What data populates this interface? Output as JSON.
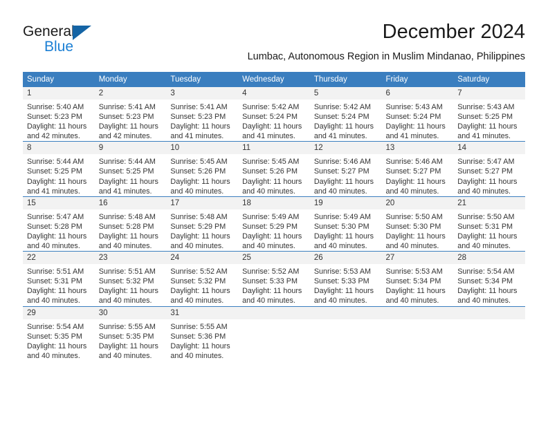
{
  "logo": {
    "primary_text": "General",
    "secondary_text": "Blue",
    "triangle_color": "#1464a5",
    "secondary_color": "#1b7fd4"
  },
  "header": {
    "month_title": "December 2024",
    "location": "Lumbac, Autonomous Region in Muslim Mindanao, Philippines"
  },
  "theme": {
    "header_bg": "#3a7ebf",
    "header_text": "#ffffff",
    "daynum_band_bg": "#f2f2f2",
    "cell_bg": "#ffffff",
    "row_border": "#3a7ebf",
    "body_text": "#333333"
  },
  "weekdays": [
    "Sunday",
    "Monday",
    "Tuesday",
    "Wednesday",
    "Thursday",
    "Friday",
    "Saturday"
  ],
  "calendar": {
    "weeks": [
      [
        {
          "day": "1",
          "sunrise": "Sunrise: 5:40 AM",
          "sunset": "Sunset: 5:23 PM",
          "daylight_line1": "Daylight: 11 hours",
          "daylight_line2": "and 42 minutes."
        },
        {
          "day": "2",
          "sunrise": "Sunrise: 5:41 AM",
          "sunset": "Sunset: 5:23 PM",
          "daylight_line1": "Daylight: 11 hours",
          "daylight_line2": "and 42 minutes."
        },
        {
          "day": "3",
          "sunrise": "Sunrise: 5:41 AM",
          "sunset": "Sunset: 5:23 PM",
          "daylight_line1": "Daylight: 11 hours",
          "daylight_line2": "and 41 minutes."
        },
        {
          "day": "4",
          "sunrise": "Sunrise: 5:42 AM",
          "sunset": "Sunset: 5:24 PM",
          "daylight_line1": "Daylight: 11 hours",
          "daylight_line2": "and 41 minutes."
        },
        {
          "day": "5",
          "sunrise": "Sunrise: 5:42 AM",
          "sunset": "Sunset: 5:24 PM",
          "daylight_line1": "Daylight: 11 hours",
          "daylight_line2": "and 41 minutes."
        },
        {
          "day": "6",
          "sunrise": "Sunrise: 5:43 AM",
          "sunset": "Sunset: 5:24 PM",
          "daylight_line1": "Daylight: 11 hours",
          "daylight_line2": "and 41 minutes."
        },
        {
          "day": "7",
          "sunrise": "Sunrise: 5:43 AM",
          "sunset": "Sunset: 5:25 PM",
          "daylight_line1": "Daylight: 11 hours",
          "daylight_line2": "and 41 minutes."
        }
      ],
      [
        {
          "day": "8",
          "sunrise": "Sunrise: 5:44 AM",
          "sunset": "Sunset: 5:25 PM",
          "daylight_line1": "Daylight: 11 hours",
          "daylight_line2": "and 41 minutes."
        },
        {
          "day": "9",
          "sunrise": "Sunrise: 5:44 AM",
          "sunset": "Sunset: 5:25 PM",
          "daylight_line1": "Daylight: 11 hours",
          "daylight_line2": "and 41 minutes."
        },
        {
          "day": "10",
          "sunrise": "Sunrise: 5:45 AM",
          "sunset": "Sunset: 5:26 PM",
          "daylight_line1": "Daylight: 11 hours",
          "daylight_line2": "and 40 minutes."
        },
        {
          "day": "11",
          "sunrise": "Sunrise: 5:45 AM",
          "sunset": "Sunset: 5:26 PM",
          "daylight_line1": "Daylight: 11 hours",
          "daylight_line2": "and 40 minutes."
        },
        {
          "day": "12",
          "sunrise": "Sunrise: 5:46 AM",
          "sunset": "Sunset: 5:27 PM",
          "daylight_line1": "Daylight: 11 hours",
          "daylight_line2": "and 40 minutes."
        },
        {
          "day": "13",
          "sunrise": "Sunrise: 5:46 AM",
          "sunset": "Sunset: 5:27 PM",
          "daylight_line1": "Daylight: 11 hours",
          "daylight_line2": "and 40 minutes."
        },
        {
          "day": "14",
          "sunrise": "Sunrise: 5:47 AM",
          "sunset": "Sunset: 5:27 PM",
          "daylight_line1": "Daylight: 11 hours",
          "daylight_line2": "and 40 minutes."
        }
      ],
      [
        {
          "day": "15",
          "sunrise": "Sunrise: 5:47 AM",
          "sunset": "Sunset: 5:28 PM",
          "daylight_line1": "Daylight: 11 hours",
          "daylight_line2": "and 40 minutes."
        },
        {
          "day": "16",
          "sunrise": "Sunrise: 5:48 AM",
          "sunset": "Sunset: 5:28 PM",
          "daylight_line1": "Daylight: 11 hours",
          "daylight_line2": "and 40 minutes."
        },
        {
          "day": "17",
          "sunrise": "Sunrise: 5:48 AM",
          "sunset": "Sunset: 5:29 PM",
          "daylight_line1": "Daylight: 11 hours",
          "daylight_line2": "and 40 minutes."
        },
        {
          "day": "18",
          "sunrise": "Sunrise: 5:49 AM",
          "sunset": "Sunset: 5:29 PM",
          "daylight_line1": "Daylight: 11 hours",
          "daylight_line2": "and 40 minutes."
        },
        {
          "day": "19",
          "sunrise": "Sunrise: 5:49 AM",
          "sunset": "Sunset: 5:30 PM",
          "daylight_line1": "Daylight: 11 hours",
          "daylight_line2": "and 40 minutes."
        },
        {
          "day": "20",
          "sunrise": "Sunrise: 5:50 AM",
          "sunset": "Sunset: 5:30 PM",
          "daylight_line1": "Daylight: 11 hours",
          "daylight_line2": "and 40 minutes."
        },
        {
          "day": "21",
          "sunrise": "Sunrise: 5:50 AM",
          "sunset": "Sunset: 5:31 PM",
          "daylight_line1": "Daylight: 11 hours",
          "daylight_line2": "and 40 minutes."
        }
      ],
      [
        {
          "day": "22",
          "sunrise": "Sunrise: 5:51 AM",
          "sunset": "Sunset: 5:31 PM",
          "daylight_line1": "Daylight: 11 hours",
          "daylight_line2": "and 40 minutes."
        },
        {
          "day": "23",
          "sunrise": "Sunrise: 5:51 AM",
          "sunset": "Sunset: 5:32 PM",
          "daylight_line1": "Daylight: 11 hours",
          "daylight_line2": "and 40 minutes."
        },
        {
          "day": "24",
          "sunrise": "Sunrise: 5:52 AM",
          "sunset": "Sunset: 5:32 PM",
          "daylight_line1": "Daylight: 11 hours",
          "daylight_line2": "and 40 minutes."
        },
        {
          "day": "25",
          "sunrise": "Sunrise: 5:52 AM",
          "sunset": "Sunset: 5:33 PM",
          "daylight_line1": "Daylight: 11 hours",
          "daylight_line2": "and 40 minutes."
        },
        {
          "day": "26",
          "sunrise": "Sunrise: 5:53 AM",
          "sunset": "Sunset: 5:33 PM",
          "daylight_line1": "Daylight: 11 hours",
          "daylight_line2": "and 40 minutes."
        },
        {
          "day": "27",
          "sunrise": "Sunrise: 5:53 AM",
          "sunset": "Sunset: 5:34 PM",
          "daylight_line1": "Daylight: 11 hours",
          "daylight_line2": "and 40 minutes."
        },
        {
          "day": "28",
          "sunrise": "Sunrise: 5:54 AM",
          "sunset": "Sunset: 5:34 PM",
          "daylight_line1": "Daylight: 11 hours",
          "daylight_line2": "and 40 minutes."
        }
      ],
      [
        {
          "day": "29",
          "sunrise": "Sunrise: 5:54 AM",
          "sunset": "Sunset: 5:35 PM",
          "daylight_line1": "Daylight: 11 hours",
          "daylight_line2": "and 40 minutes."
        },
        {
          "day": "30",
          "sunrise": "Sunrise: 5:55 AM",
          "sunset": "Sunset: 5:35 PM",
          "daylight_line1": "Daylight: 11 hours",
          "daylight_line2": "and 40 minutes."
        },
        {
          "day": "31",
          "sunrise": "Sunrise: 5:55 AM",
          "sunset": "Sunset: 5:36 PM",
          "daylight_line1": "Daylight: 11 hours",
          "daylight_line2": "and 40 minutes."
        },
        {
          "day": "",
          "sunrise": "",
          "sunset": "",
          "daylight_line1": "",
          "daylight_line2": ""
        },
        {
          "day": "",
          "sunrise": "",
          "sunset": "",
          "daylight_line1": "",
          "daylight_line2": ""
        },
        {
          "day": "",
          "sunrise": "",
          "sunset": "",
          "daylight_line1": "",
          "daylight_line2": ""
        },
        {
          "day": "",
          "sunrise": "",
          "sunset": "",
          "daylight_line1": "",
          "daylight_line2": ""
        }
      ]
    ]
  }
}
